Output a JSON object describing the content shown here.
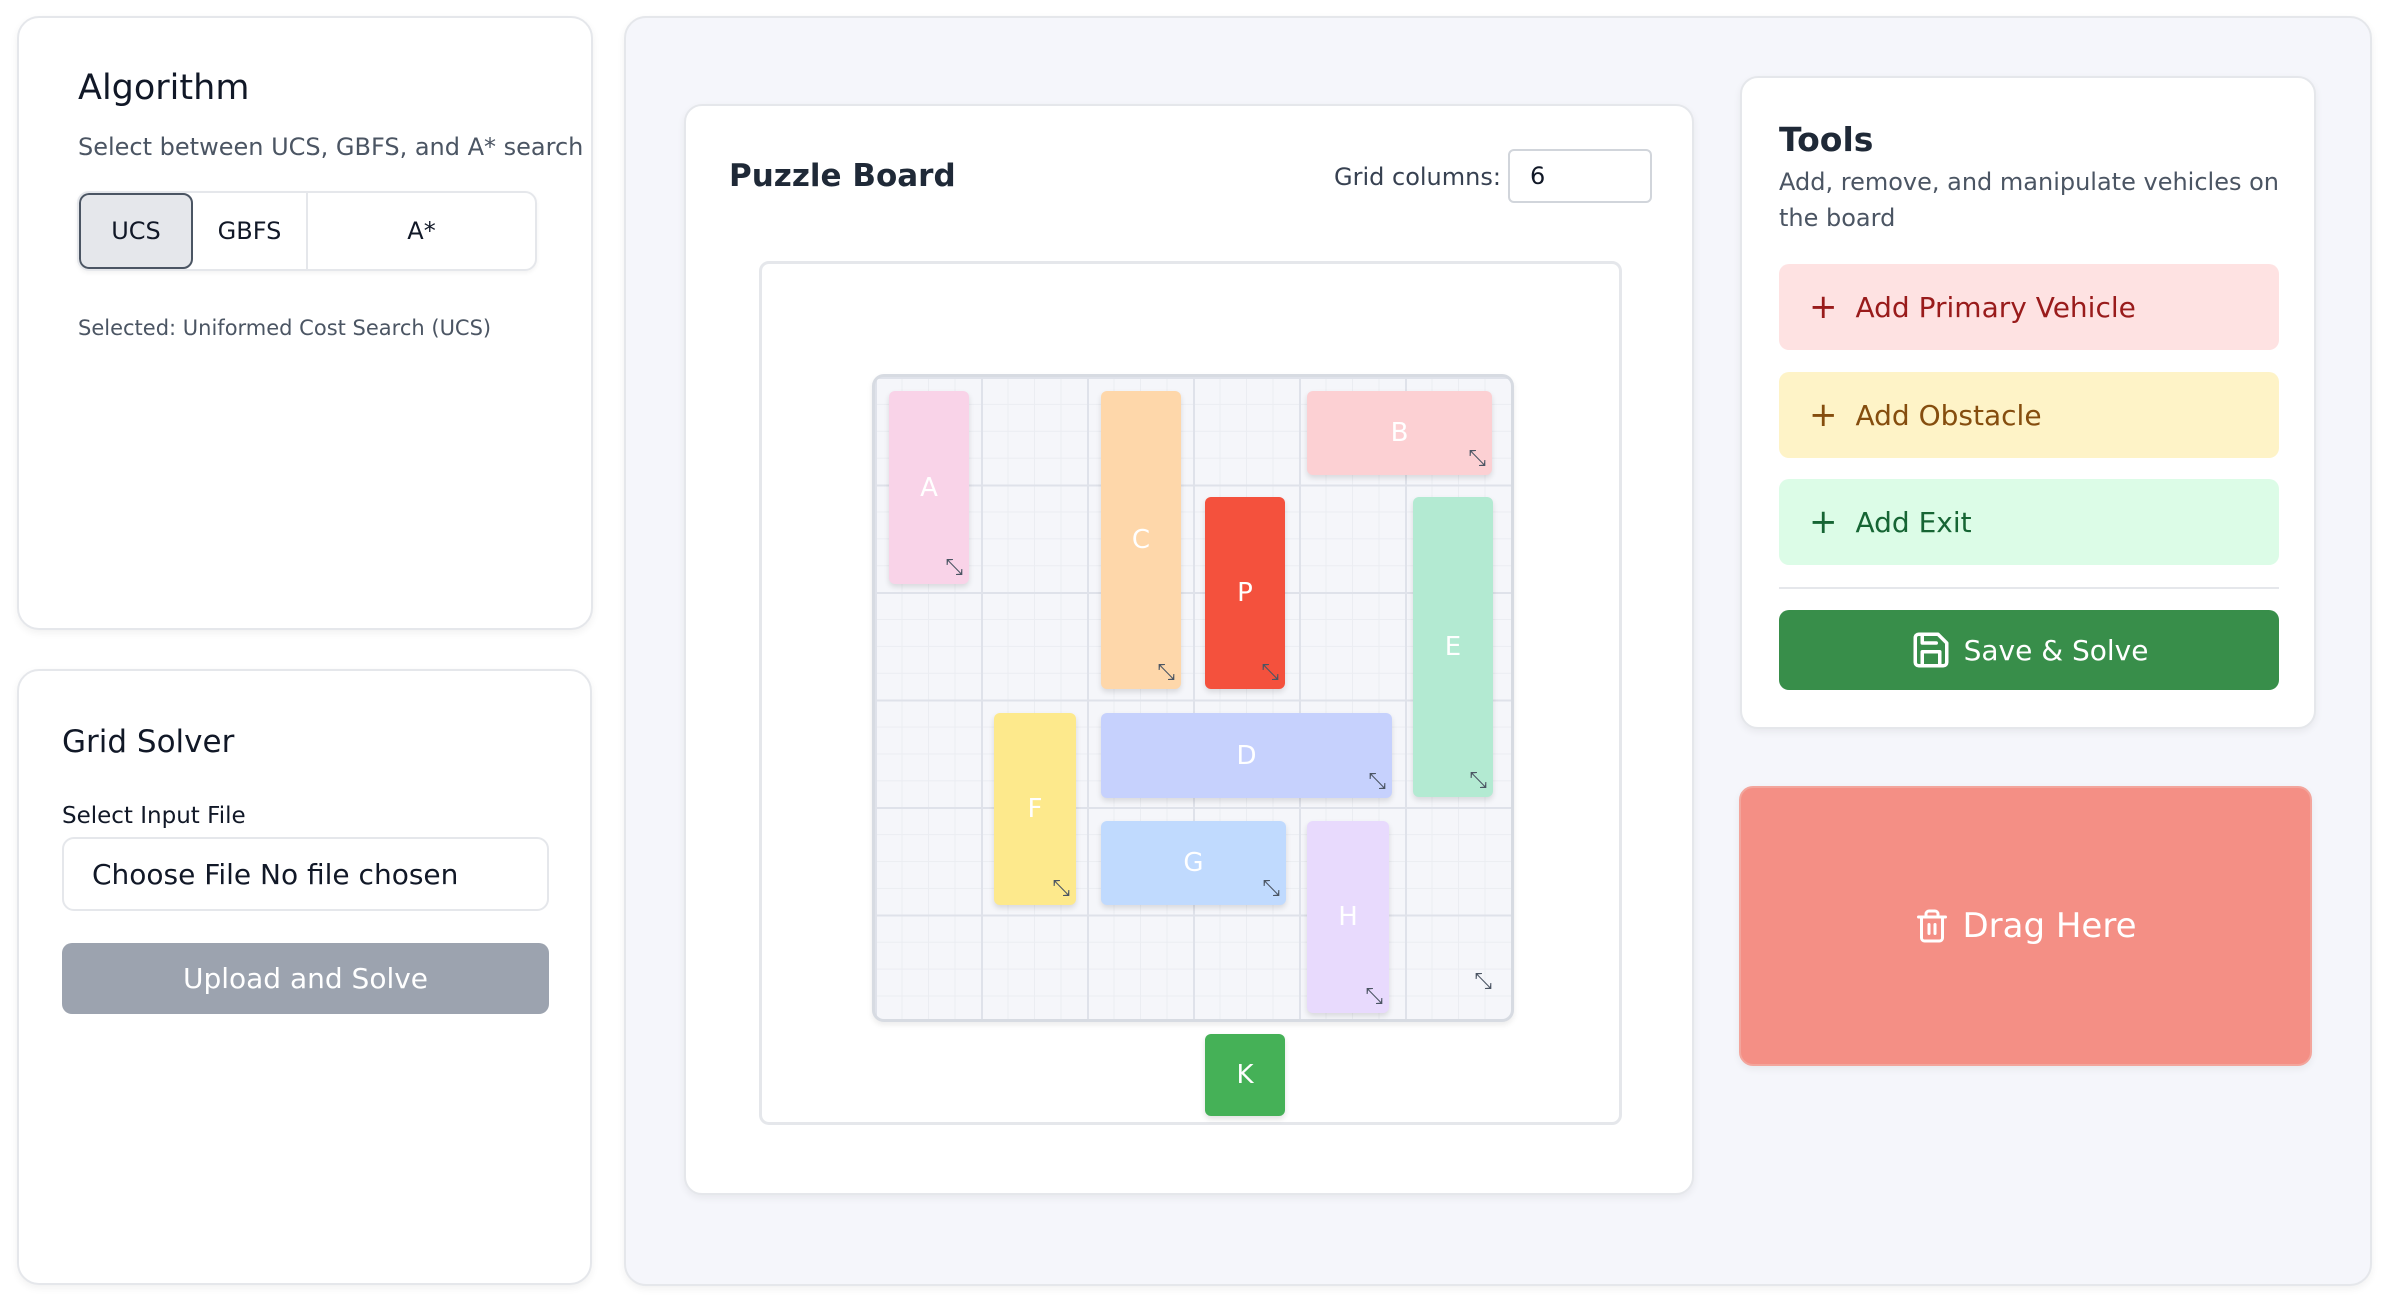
{
  "algorithm": {
    "title": "Algorithm",
    "subtitle": "Select between UCS, GBFS, and A* search",
    "options": [
      "UCS",
      "GBFS",
      "A*"
    ],
    "selected_option": "UCS",
    "selected_text": "Selected: Uniformed Cost Search (UCS)"
  },
  "solver": {
    "title": "Grid Solver",
    "file_label": "Select Input File",
    "file_input_text": "Choose File No file chosen",
    "upload_label": "Upload and Solve"
  },
  "board": {
    "title": "Puzzle Board",
    "grid_columns_label": "Grid columns:",
    "grid_columns_value": "6",
    "vehicles": [
      {
        "id": "A",
        "color": "#f9d3e8"
      },
      {
        "id": "B",
        "color": "#fcd0d3"
      },
      {
        "id": "C",
        "color": "#fed7aa"
      },
      {
        "id": "P",
        "color": "#f4513d"
      },
      {
        "id": "E",
        "color": "#b3ead2"
      },
      {
        "id": "D",
        "color": "#c6d1fd"
      },
      {
        "id": "F",
        "color": "#fde98c"
      },
      {
        "id": "G",
        "color": "#c0dafe"
      },
      {
        "id": "H",
        "color": "#e8dafd"
      },
      {
        "id": "K",
        "color": "#45b157"
      }
    ]
  },
  "tools": {
    "title": "Tools",
    "subtitle": "Add, remove, and manipulate vehicles on the board",
    "add_primary": "Add Primary Vehicle",
    "add_obstacle": "Add Obstacle",
    "add_exit": "Add Exit",
    "save_solve": "Save & Solve",
    "plus_glyph": "+"
  },
  "dropzone": {
    "label": "Drag Here"
  }
}
